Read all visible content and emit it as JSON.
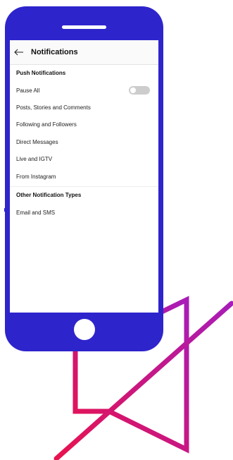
{
  "header": {
    "title": "Notifications"
  },
  "push": {
    "heading": "Push Notifications",
    "items": [
      {
        "label": "Pause All"
      },
      {
        "label": "Posts, Stories and Comments"
      },
      {
        "label": "Following and Followers"
      },
      {
        "label": "Direct Messages"
      },
      {
        "label": "Live and IGTV"
      },
      {
        "label": "From Instagram"
      }
    ]
  },
  "other": {
    "heading": "Other Notification Types",
    "items": [
      {
        "label": "Email and SMS"
      }
    ]
  },
  "pause_all_toggle": {
    "on": false
  },
  "icons": {
    "back": "arrow-left-icon",
    "mute": "speaker-mute-icon"
  },
  "colors": {
    "phone_body": "#2e24cc",
    "mute_gradient_start": "#e8124e",
    "mute_gradient_end": "#a81cb8",
    "toggle_off": "#cdcdcd"
  }
}
